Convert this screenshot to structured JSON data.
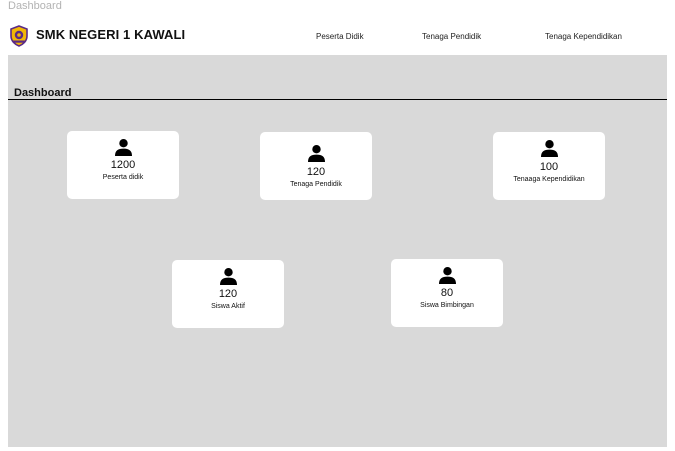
{
  "frame": {
    "label": "Dashboard"
  },
  "navbar": {
    "school_name": "SMK NEGERI 1 KAWALI",
    "links": [
      "Peserta Didik",
      "Tenaga Pendidik",
      "Tenaga Kependidikan"
    ]
  },
  "page": {
    "heading": "Dashboard"
  },
  "cards": [
    {
      "icon": "user-icon",
      "count": "1200",
      "label": "Peserta didik"
    },
    {
      "icon": "user-icon",
      "count": "120",
      "label": "Tenaga Pendidik"
    },
    {
      "icon": "user-icon",
      "count": "100",
      "label": "Tenaaga Kependidikan"
    },
    {
      "icon": "user-icon",
      "count": "120",
      "label": "Siswa Aktif"
    },
    {
      "icon": "user-icon",
      "count": "80",
      "label": "Siswa Bimbingan"
    }
  ],
  "colors": {
    "canvas": "#d9d9d9",
    "card": "#ffffff",
    "logo_purple": "#5b2a86",
    "logo_gold": "#f2b705"
  }
}
